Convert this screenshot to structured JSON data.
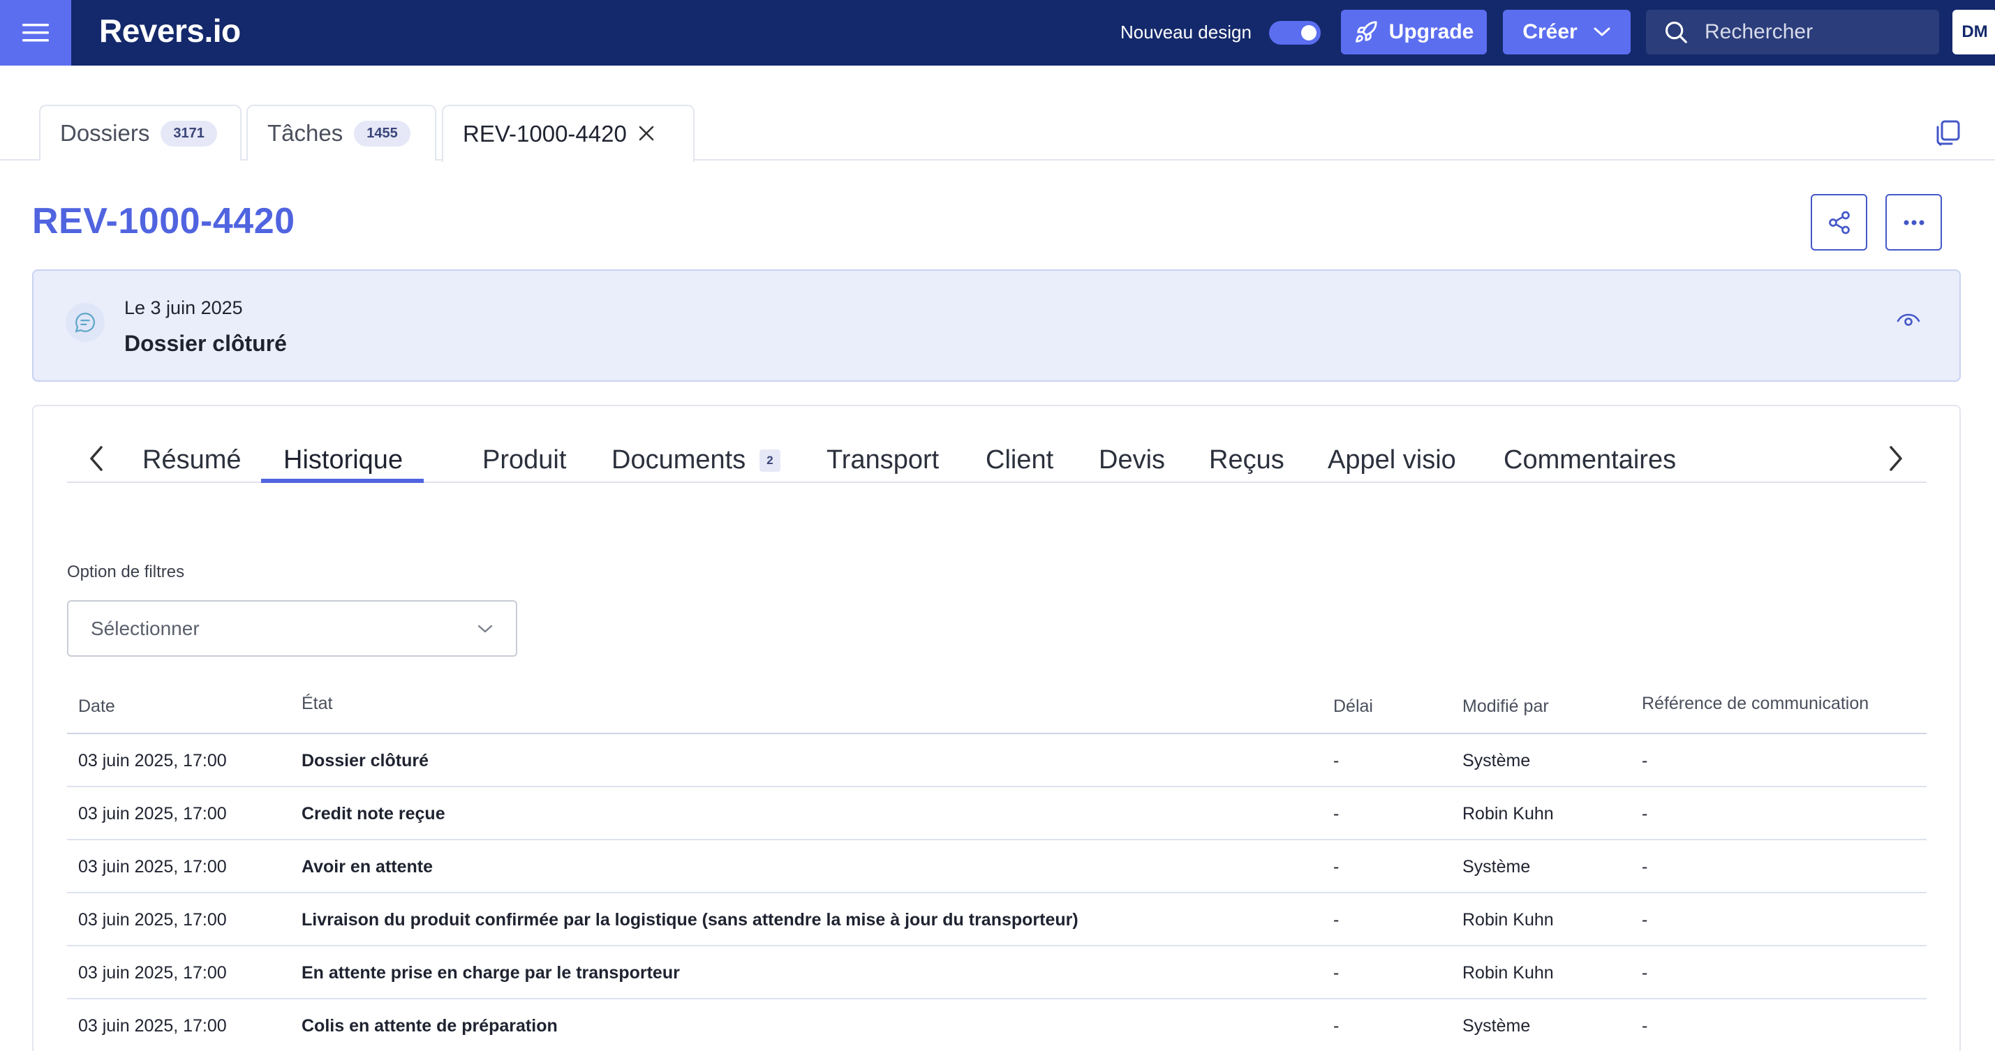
{
  "app": {
    "logo": "Revers.io"
  },
  "topbar": {
    "new_design_label": "Nouveau design",
    "upgrade_label": "Upgrade",
    "create_label": "Créer",
    "search_placeholder": "Rechercher",
    "user_initials": "DM"
  },
  "tabs": [
    {
      "label": "Dossiers",
      "count": "3171"
    },
    {
      "label": "Tâches",
      "count": "1455"
    },
    {
      "label": "REV-1000-4420"
    }
  ],
  "page": {
    "title": "REV-1000-4420"
  },
  "banner": {
    "date": "Le 3 juin 2025",
    "status": "Dossier clôturé"
  },
  "subtabs": [
    {
      "label": "Résumé"
    },
    {
      "label": "Historique"
    },
    {
      "label": "Produit"
    },
    {
      "label": "Documents",
      "badge": "2"
    },
    {
      "label": "Transport"
    },
    {
      "label": "Client"
    },
    {
      "label": "Devis"
    },
    {
      "label": "Reçus"
    },
    {
      "label": "Appel visio"
    },
    {
      "label": "Commentaires"
    }
  ],
  "filter": {
    "label": "Option de filtres",
    "placeholder": "Sélectionner"
  },
  "table": {
    "headers": [
      "Date",
      "État",
      "Délai",
      "Modifié par",
      "Référence de communication"
    ],
    "rows": [
      [
        "03 juin 2025, 17:00",
        "Dossier clôturé",
        "-",
        "Système",
        "-"
      ],
      [
        "03 juin 2025, 17:00",
        "Credit note reçue",
        "-",
        "Robin Kuhn",
        "-"
      ],
      [
        "03 juin 2025, 17:00",
        "Avoir en attente",
        "-",
        "Système",
        "-"
      ],
      [
        "03 juin 2025, 17:00",
        "Livraison du produit confirmée par la logistique (sans attendre la mise à jour du transporteur)",
        "-",
        "Robin Kuhn",
        "-"
      ],
      [
        "03 juin 2025, 17:00",
        "En attente prise en charge par le transporteur",
        "-",
        "Robin Kuhn",
        "-"
      ],
      [
        "03 juin 2025, 17:00",
        "Colis en attente de préparation",
        "-",
        "Système",
        "-"
      ]
    ]
  },
  "colors": {
    "navy": "#14296b",
    "accent": "#5b6ef0",
    "title": "#5064e0",
    "banner_bg": "#eaeefb"
  },
  "icons": [
    "hamburger-icon",
    "rocket-icon",
    "chevron-down-icon",
    "search-icon",
    "close-icon",
    "copy-icon",
    "share-icon",
    "more-icon",
    "chat-icon",
    "eye-icon",
    "chevron-left-icon",
    "chevron-right-icon"
  ]
}
